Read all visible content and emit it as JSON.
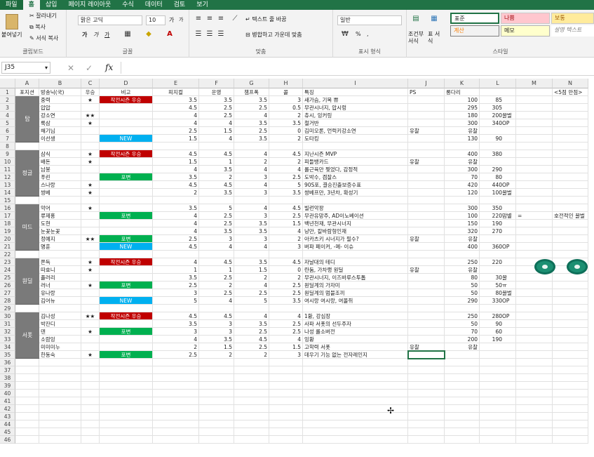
{
  "tabs": [
    "파일",
    "홈",
    "삽입",
    "페이지 레이아웃",
    "수식",
    "데이터",
    "검토",
    "보기"
  ],
  "clipboard": {
    "paste": "붙여넣기",
    "cut": "잘라내기",
    "copy": "복사",
    "format_copy": "서식 복사",
    "label": "클립보드"
  },
  "font": {
    "name": "맑은 고딕",
    "size": "10",
    "grow": "가",
    "shrink": "가",
    "bold": "가",
    "italic": "가",
    "underline": "가",
    "label": "글꼴"
  },
  "align": {
    "wrap": "텍스트 줄 바꿈",
    "merge": "병합하고 가운데 맞춤",
    "label": "맞춤"
  },
  "number": {
    "format": "일반",
    "percent": "%",
    "comma": ",",
    "label": "표시 형식"
  },
  "styles": {
    "cond": "조건부 서식",
    "table": "표 서식",
    "normal": "표준",
    "bad": "나쁨",
    "good": "보통",
    "calc": "계산",
    "memo": "메모",
    "explain": "설명 텍스트",
    "label": "스타일"
  },
  "namebox": "J35",
  "fx": "fx",
  "col_letters": [
    "A",
    "B",
    "C",
    "D",
    "E",
    "F",
    "G",
    "H",
    "I",
    "J",
    "K",
    "L",
    "M",
    "N"
  ],
  "headers": [
    "포지션",
    "방송닉(국)",
    "우승",
    "비고",
    "피지컬",
    "운영",
    "챔프폭",
    "콜",
    "특징",
    "PS",
    "롱다리",
    "",
    "",
    "<5점 만점>"
  ],
  "positions": [
    {
      "name": "탑",
      "start": 2,
      "end": 7
    },
    {
      "name": "정글",
      "start": 9,
      "end": 14
    },
    {
      "name": "미드",
      "start": 16,
      "end": 21
    },
    {
      "name": "원딜",
      "start": 23,
      "end": 28
    },
    {
      "name": "서폿",
      "start": 30,
      "end": 35
    }
  ],
  "rows": [
    {
      "n": 2,
      "b": "중력",
      "c": "★",
      "d": "작전시즌 우승",
      "t": "red",
      "e": "3.5",
      "f": "3.5",
      "g": "3.5",
      "h": "3",
      "i": "새가슴, 기복 쀼",
      "j": "",
      "k": "100",
      "l": "85",
      "m": ""
    },
    {
      "n": 3,
      "b": "압압",
      "c": "",
      "d": "",
      "t": "",
      "e": "4.5",
      "f": "2.5",
      "g": "2.5",
      "h": "0.5",
      "i": "무관시너지, 압시렁",
      "j": "",
      "k": "295",
      "l": "305",
      "m": ""
    },
    {
      "n": 4,
      "b": "강소연",
      "c": "★★",
      "d": "",
      "t": "",
      "e": "4",
      "f": "2.5",
      "g": "4",
      "h": "2",
      "i": "츄시, 잉커링",
      "j": "",
      "k": "180",
      "l": "200 꿀벌",
      "m": ""
    },
    {
      "n": 5,
      "b": "룩삼",
      "c": "★",
      "d": "",
      "t": "",
      "e": "4",
      "f": "4",
      "g": "3.5",
      "h": "3.5",
      "i": "철거반",
      "j": "",
      "k": "300",
      "l": "340 OP",
      "m": ""
    },
    {
      "n": 6,
      "b": "해기님",
      "c": "",
      "d": "",
      "t": "",
      "e": "2.5",
      "f": "1.5",
      "g": "2.5",
      "h": "0",
      "i": "김미오론, 언럭키강소연",
      "j": "유찰",
      "k": "유찰",
      "l": "",
      "m": ""
    },
    {
      "n": 7,
      "b": "이선생",
      "c": "",
      "d": "NEW",
      "t": "blue",
      "e": "1.5",
      "f": "4",
      "g": "3.5",
      "h": "2",
      "i": "도타킹",
      "j": "",
      "k": "130",
      "l": "90",
      "m": ""
    },
    {
      "n": 9,
      "b": "삼식",
      "c": "★",
      "d": "작전시즌 우승",
      "t": "red",
      "e": "4.5",
      "f": "4.5",
      "g": "4",
      "h": "4.5",
      "i": "지난시즌 MVP",
      "j": "",
      "k": "400",
      "l": "380",
      "m": ""
    },
    {
      "n": 10,
      "b": "배돈",
      "c": "★",
      "d": "",
      "t": "",
      "e": "1.5",
      "f": "1",
      "g": "2",
      "h": "2",
      "i": "피들뱅카드",
      "j": "유찰",
      "k": "유찰",
      "l": "",
      "m": ""
    },
    {
      "n": 11,
      "b": "남봉",
      "c": "",
      "d": "",
      "t": "",
      "e": "4",
      "f": "3.5",
      "g": "4",
      "h": "4",
      "i": "롤근육만 찢었다, 감정적",
      "j": "",
      "k": "300",
      "l": "290",
      "m": ""
    },
    {
      "n": 12,
      "b": "푸린",
      "c": "",
      "d": "포변",
      "t": "green",
      "e": "3.5",
      "f": "2",
      "g": "3",
      "h": "2.5",
      "i": "도박수, 겜잘스",
      "j": "",
      "k": "70",
      "l": "80",
      "m": ""
    },
    {
      "n": 13,
      "b": "스나랑",
      "c": "★",
      "d": "",
      "t": "",
      "e": "4.5",
      "f": "4.5",
      "g": "4",
      "h": "5",
      "i": "90S포, 결승진출보증수표",
      "j": "",
      "k": "420",
      "l": "440 OP",
      "m": ""
    },
    {
      "n": 14,
      "b": "쌍베",
      "c": "★",
      "d": "",
      "t": "",
      "e": "2",
      "f": "3.5",
      "g": "3",
      "h": "3.5",
      "i": "쌍베프만, 3년차, 확성기",
      "j": "",
      "k": "120",
      "l": "100 꿀벌",
      "m": ""
    },
    {
      "n": 16,
      "b": "악어",
      "c": "★",
      "d": "",
      "t": "",
      "e": "3.5",
      "f": "5",
      "g": "4",
      "h": "4.5",
      "i": "빌런악팡",
      "j": "",
      "k": "300",
      "l": "350",
      "m": ""
    },
    {
      "n": 17,
      "b": "류제홍",
      "c": "",
      "d": "포변",
      "t": "green",
      "e": "4",
      "f": "2.5",
      "g": "3",
      "h": "2.5",
      "i": "무관유망주, AD이노베이션",
      "j": "",
      "k": "100",
      "l": "220 맘별",
      "m": "="
    },
    {
      "n": 18,
      "b": "도현",
      "c": "",
      "d": "",
      "t": "",
      "e": "4",
      "f": "2.5",
      "g": "3.5",
      "h": "1.5",
      "i": "백년천재, 무관시너지",
      "j": "",
      "k": "150",
      "l": "190",
      "m": ""
    },
    {
      "n": 19,
      "b": "눈꽃눈꽃",
      "c": "",
      "d": "",
      "t": "",
      "e": "4",
      "f": "3.5",
      "g": "3.5",
      "h": "4",
      "i": "낭만, 칼바람형인재",
      "j": "",
      "k": "320",
      "l": "270",
      "m": ""
    },
    {
      "n": 20,
      "b": "정예지",
      "c": "★★",
      "d": "포변",
      "t": "green",
      "e": "2.5",
      "f": "3",
      "g": "3",
      "h": "2",
      "i": "아카츠키 시너지가 필수?",
      "j": "유찰",
      "k": "유찰",
      "l": "",
      "m": ""
    },
    {
      "n": 21,
      "b": "명훈",
      "c": "",
      "d": "NEW",
      "t": "blue",
      "e": "4.5",
      "f": "4",
      "g": "4",
      "h": "3",
      "i": "버파 페이커, -메- 이슈",
      "j": "",
      "k": "400",
      "l": "360 OP",
      "m": ""
    },
    {
      "n": 23,
      "b": "쫀득",
      "c": "★",
      "d": "작전시즌 우승",
      "t": "red",
      "e": "4",
      "f": "4.5",
      "g": "3.5",
      "h": "4.5",
      "i": "자날대의 테디",
      "j": "",
      "k": "250",
      "l": "220",
      "m": ""
    },
    {
      "n": 24,
      "b": "따효니",
      "c": "★",
      "d": "",
      "t": "",
      "e": "1",
      "f": "1",
      "g": "1.5",
      "h": "0",
      "i": "란둠, 가차랭 원딜",
      "j": "유찰",
      "k": "유찰",
      "l": "",
      "m": ""
    },
    {
      "n": 25,
      "b": "플러리",
      "c": "",
      "d": "",
      "t": "",
      "e": "3.5",
      "f": "2.5",
      "g": "2",
      "h": "2",
      "i": "무관시너지, 이즈바루스투톱",
      "j": "",
      "k": "80",
      "l": "30 꿀",
      "m": ""
    },
    {
      "n": 26,
      "b": "러너",
      "c": "★",
      "d": "포변",
      "t": "green",
      "e": "2.5",
      "f": "2",
      "g": "4",
      "h": "2.5",
      "i": "원딜계의 가자미",
      "j": "",
      "k": "50",
      "l": "50 ㅠ",
      "m": ""
    },
    {
      "n": 27,
      "b": "유나랑",
      "c": "",
      "d": "",
      "t": "",
      "e": "3",
      "f": "2.5",
      "g": "2.5",
      "h": "2.5",
      "i": "원딜계의 멈블조끼",
      "j": "",
      "k": "50",
      "l": "80 꿀벌",
      "m": ""
    },
    {
      "n": 28,
      "b": "김어뉴",
      "c": "",
      "d": "NEW",
      "t": "blue",
      "e": "5",
      "f": "4",
      "g": "5",
      "h": "3.5",
      "i": "여시랑 여시랑, 여몰쥐",
      "j": "",
      "k": "290",
      "l": "330 OP",
      "m": ""
    },
    {
      "n": 30,
      "b": "김나성",
      "c": "★★",
      "d": "작전시즌 우승",
      "t": "red",
      "e": "4.5",
      "f": "4.5",
      "g": "4",
      "h": "4",
      "i": "1황, 강심장",
      "j": "",
      "k": "250",
      "l": "280 OP",
      "m": ""
    },
    {
      "n": 31,
      "b": "박잔디",
      "c": "",
      "d": "",
      "t": "",
      "e": "3.5",
      "f": "3",
      "g": "3.5",
      "h": "2.5",
      "i": "사파 서폿의 선두주자",
      "j": "",
      "k": "50",
      "l": "90",
      "m": ""
    },
    {
      "n": 32,
      "b": "덴",
      "c": "★",
      "d": "포변",
      "t": "green",
      "e": "3",
      "f": "3",
      "g": "2.5",
      "h": "2.5",
      "i": "나성 롤소버전",
      "j": "",
      "k": "70",
      "l": "60",
      "m": ""
    },
    {
      "n": 33,
      "b": "소람잉",
      "c": "",
      "d": "",
      "t": "",
      "e": "4",
      "f": "3.5",
      "g": "4.5",
      "h": "4",
      "i": "잉황",
      "j": "",
      "k": "200",
      "l": "190",
      "m": ""
    },
    {
      "n": 34,
      "b": "미미미누",
      "c": "",
      "d": "",
      "t": "",
      "e": "2",
      "f": "1.5",
      "g": "2.5",
      "h": "1.5",
      "i": "고학력 서폿",
      "j": "유찰",
      "k": "유찰",
      "l": "",
      "m": ""
    },
    {
      "n": 35,
      "b": "한동숙",
      "c": "★",
      "d": "포변",
      "t": "green",
      "e": "2.5",
      "f": "2",
      "g": "2",
      "h": "3",
      "i": "데우기 기능 없는 전자레인지",
      "j": "",
      "k": "",
      "l": "",
      "m": ""
    }
  ],
  "n17_note": "호전적인 꿀벌",
  "row_numbers": [
    1,
    2,
    3,
    4,
    5,
    6,
    7,
    8,
    9,
    10,
    11,
    12,
    13,
    14,
    15,
    16,
    17,
    18,
    19,
    20,
    21,
    22,
    23,
    24,
    25,
    26,
    27,
    28,
    29,
    30,
    31,
    32,
    33,
    34,
    35,
    36,
    37,
    38,
    39,
    40,
    41,
    42,
    43,
    44,
    45,
    46
  ]
}
